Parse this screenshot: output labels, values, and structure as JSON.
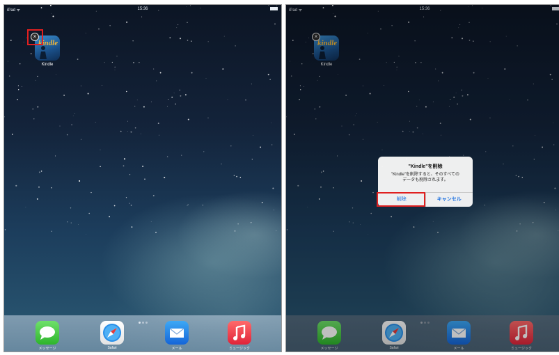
{
  "status_bar": {
    "carrier": "iPad ᯤ",
    "time": "15:36"
  },
  "kindle_app": {
    "label": "Kindle",
    "logo_text": "kindle",
    "delete_badge": "×"
  },
  "alert": {
    "title": "\"Kindle\"を削除",
    "message_line1": "\"Kindle\"を削除すると、そのすべての",
    "message_line2": "データも削除されます。",
    "delete_label": "削除",
    "cancel_label": "キャンセル"
  },
  "dock": {
    "apps": [
      {
        "icon": "messages-icon",
        "label": "メッセージ"
      },
      {
        "icon": "safari-icon",
        "label": "Safari"
      },
      {
        "icon": "mail-icon",
        "label": "メール"
      },
      {
        "icon": "music-icon",
        "label": "ミュージック"
      }
    ]
  },
  "colors": {
    "highlight": "#e02020",
    "alert_button": "#1a6fe0",
    "kindle_logo": "#f2b63a"
  }
}
